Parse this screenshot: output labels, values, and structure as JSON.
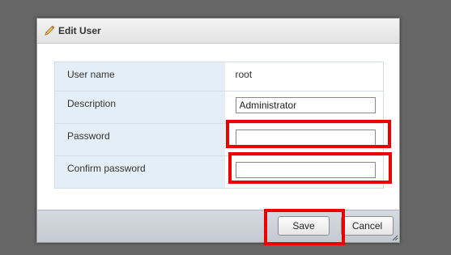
{
  "dialog": {
    "title": "Edit User",
    "title_icon": "pencil-icon"
  },
  "form": {
    "rows": [
      {
        "label": "User name",
        "value": "root"
      },
      {
        "label": "Description",
        "value": "Administrator"
      },
      {
        "label": "Password",
        "value": ""
      },
      {
        "label": "Confirm password",
        "value": ""
      }
    ]
  },
  "footer": {
    "save_label": "Save",
    "cancel_label": "Cancel"
  },
  "colors": {
    "highlight": "#ee0000",
    "label_background": "#e4eef6",
    "page_background": "#666666"
  }
}
